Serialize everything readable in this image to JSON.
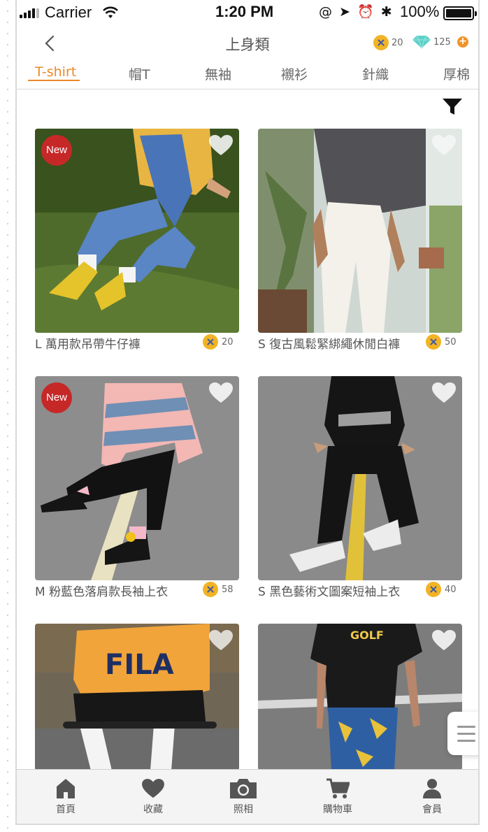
{
  "status_bar": {
    "carrier": "Carrier",
    "time": "1:20 PM",
    "icons": "@ ➤ ⏰ ✱",
    "battery": "100%"
  },
  "nav": {
    "title": "上身類",
    "coins": "20",
    "gems": "125",
    "plus": "+"
  },
  "tabs": [
    {
      "label": "T-shirt",
      "active": true
    },
    {
      "label": "帽T",
      "active": false
    },
    {
      "label": "無袖",
      "active": false
    },
    {
      "label": "襯衫",
      "active": false
    },
    {
      "label": "針織",
      "active": false
    },
    {
      "label": "厚棉",
      "active": false
    }
  ],
  "products": [
    {
      "name": "L  萬用款吊帶牛仔褲",
      "price": "20",
      "badge": "New",
      "scene": "grass-overalls"
    },
    {
      "name": "S  復古風鬆緊綁繩休閒白褲",
      "price": "50",
      "badge": "",
      "scene": "window-white-pants"
    },
    {
      "name": "M  粉藍色落肩款長袖上衣",
      "price": "58",
      "badge": "New",
      "scene": "road-stripe-shirt"
    },
    {
      "name": "S  黑色藝術文圖案短袖上衣",
      "price": "40",
      "badge": "",
      "scene": "road-black-tee"
    },
    {
      "name": "",
      "price": "",
      "badge": "",
      "scene": "orange-hoodie-skateboard"
    },
    {
      "name": "",
      "price": "",
      "badge": "",
      "scene": "black-golf-tee"
    }
  ],
  "bottom_tabs": [
    {
      "label": "首頁",
      "icon": "home-icon"
    },
    {
      "label": "收藏",
      "icon": "heart-icon"
    },
    {
      "label": "照相",
      "icon": "camera-icon"
    },
    {
      "label": "購物車",
      "icon": "cart-icon"
    },
    {
      "label": "會員",
      "icon": "user-icon"
    }
  ],
  "colors": {
    "accent": "#e8892a",
    "new_badge": "#c62828",
    "coin": "#f2b324",
    "gem": "#5fd0c8",
    "icon_gray": "#555555"
  }
}
